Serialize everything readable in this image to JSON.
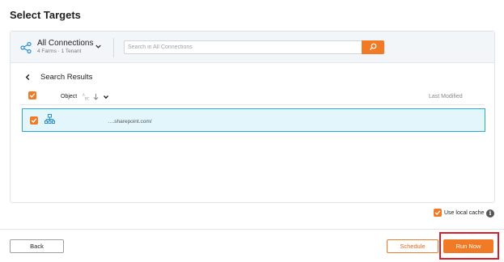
{
  "page": {
    "title": "Select Targets"
  },
  "connections": {
    "title": "All Connections",
    "subtitle": "4 Farms · 1 Tenant",
    "icon": "share-nodes-icon",
    "caret_icon": "chevron-down-icon"
  },
  "search": {
    "placeholder": "Search in All Connections",
    "value": "",
    "button_icon": "search-icon"
  },
  "results": {
    "title": "Search Results",
    "columns": {
      "object": "Object",
      "last_modified": "Last Modified"
    },
    "select_all_checked": true,
    "rows": [
      {
        "checked": true,
        "icon": "site-hierarchy-icon",
        "url": "….sharepoint.com/",
        "last_modified": ""
      }
    ]
  },
  "options": {
    "local_cache_label": "Use local cache",
    "local_cache_checked": true,
    "info_icon": "info-icon",
    "info_glyph": "i"
  },
  "footer": {
    "back_label": "Back",
    "schedule_label": "Schedule",
    "run_label": "Run Now"
  },
  "colors": {
    "accent": "#f07a25",
    "selection_border": "#29a9d8",
    "selection_bg": "#e3f6fc",
    "highlight": "#d61f26"
  }
}
